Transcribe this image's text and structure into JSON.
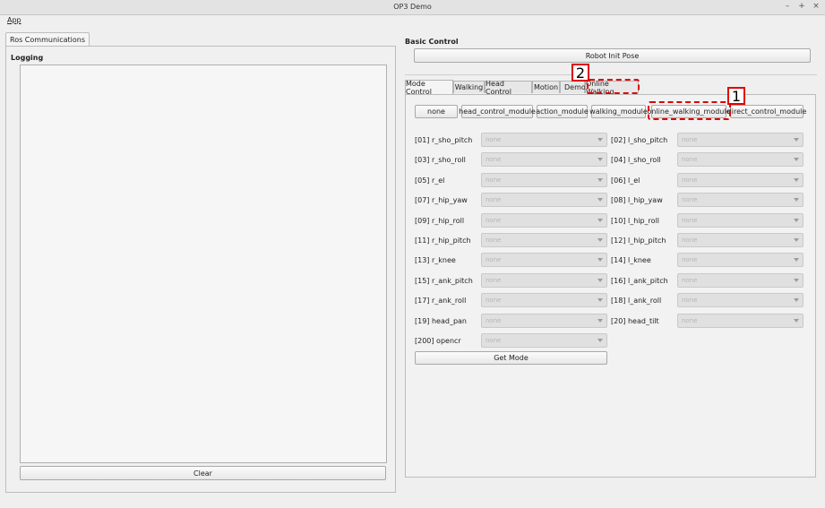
{
  "window": {
    "title": "OP3 Demo",
    "min": "–",
    "max": "+",
    "close": "×"
  },
  "menu": {
    "app": "App"
  },
  "left": {
    "tab": "Ros Communications",
    "logging": "Logging",
    "clear": "Clear"
  },
  "right": {
    "basic_control": "Basic Control",
    "init_pose": "Robot Init Pose",
    "tabs": [
      "Mode Control",
      "Walking",
      "Head Control",
      "Motion",
      "Demo",
      "Online Walking"
    ],
    "modules": [
      "none",
      "head_control_module",
      "action_module",
      "walking_module",
      "online_walking_module",
      "direct_control_module"
    ],
    "joints_left": [
      "[01] r_sho_pitch",
      "[03] r_sho_roll",
      "[05] r_el",
      "[07] r_hip_yaw",
      "[09] r_hip_roll",
      "[11] r_hip_pitch",
      "[13] r_knee",
      "[15] r_ank_pitch",
      "[17] r_ank_roll",
      "[19] head_pan",
      "[200] opencr"
    ],
    "joints_right": [
      "[02] l_sho_pitch",
      "[04] l_sho_roll",
      "[06] l_el",
      "[08] l_hip_yaw",
      "[10] l_hip_roll",
      "[12] l_hip_pitch",
      "[14] l_knee",
      "[16] l_ank_pitch",
      "[18] l_ank_roll",
      "[20] head_tilt"
    ],
    "combo_value": "none",
    "get_mode": "Get Mode"
  },
  "annotations": {
    "one": "1",
    "two": "2"
  }
}
